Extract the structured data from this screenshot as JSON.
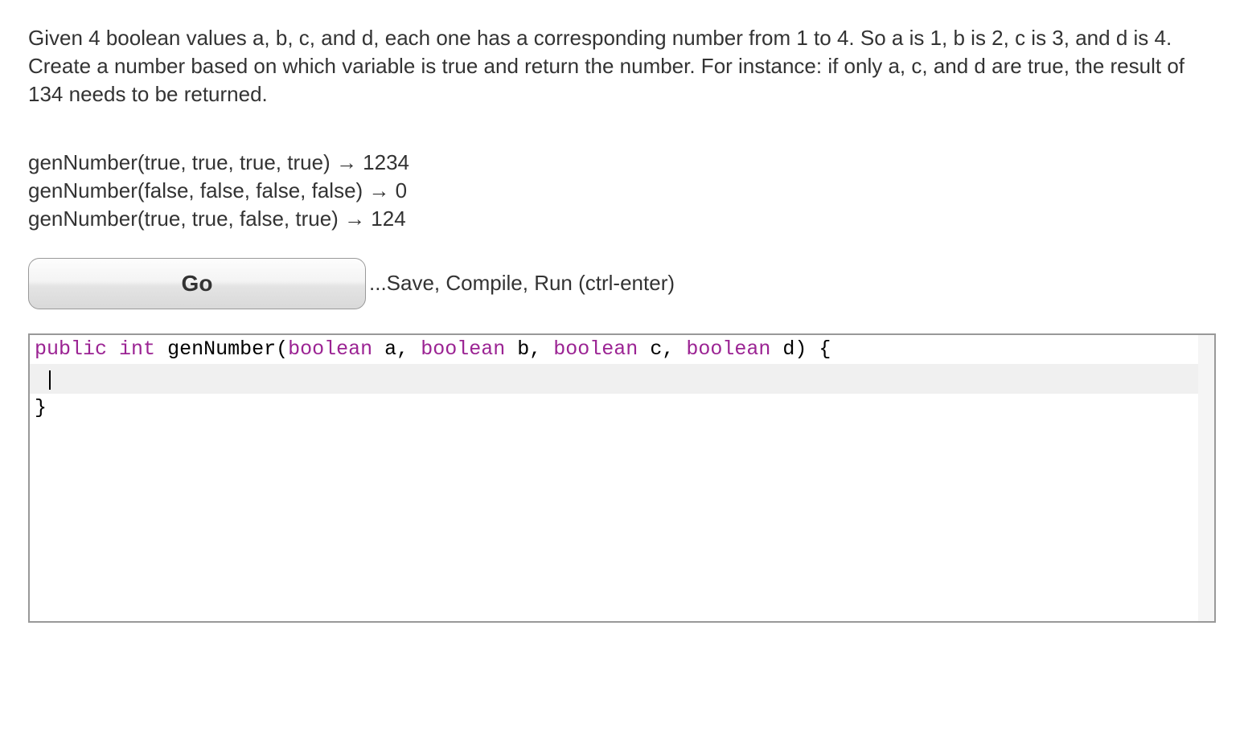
{
  "problem": {
    "description": "Given 4 boolean values a, b, c, and d, each one has a corresponding number from 1 to 4. So a is 1, b is 2, c is 3, and d is 4. Create a number based on which variable is true and return the number. For instance: if only a, c, and d are true, the result of 134 needs to be returned."
  },
  "examples": {
    "line1": "genNumber(true, true, true, true) → 1234",
    "line2": "genNumber(false, false, false, false) → 0",
    "line3": "genNumber(true, true, false, true) → 124"
  },
  "controls": {
    "go_label": "Go",
    "hint": "...Save, Compile, Run (ctrl-enter)"
  },
  "code": {
    "tokens": {
      "kw_public": "public",
      "kw_int": "int",
      "fn_name": "genNumber",
      "lparen": "(",
      "kw_boolean1": "boolean",
      "param_a": "a",
      "comma1": ", ",
      "kw_boolean2": "boolean",
      "param_b": "b",
      "comma2": ", ",
      "kw_boolean3": "boolean",
      "param_c": "c",
      "comma3": ", ",
      "kw_boolean4": "boolean",
      "param_d": "d",
      "rparen_brace": ") {",
      "close_brace": "}"
    }
  }
}
